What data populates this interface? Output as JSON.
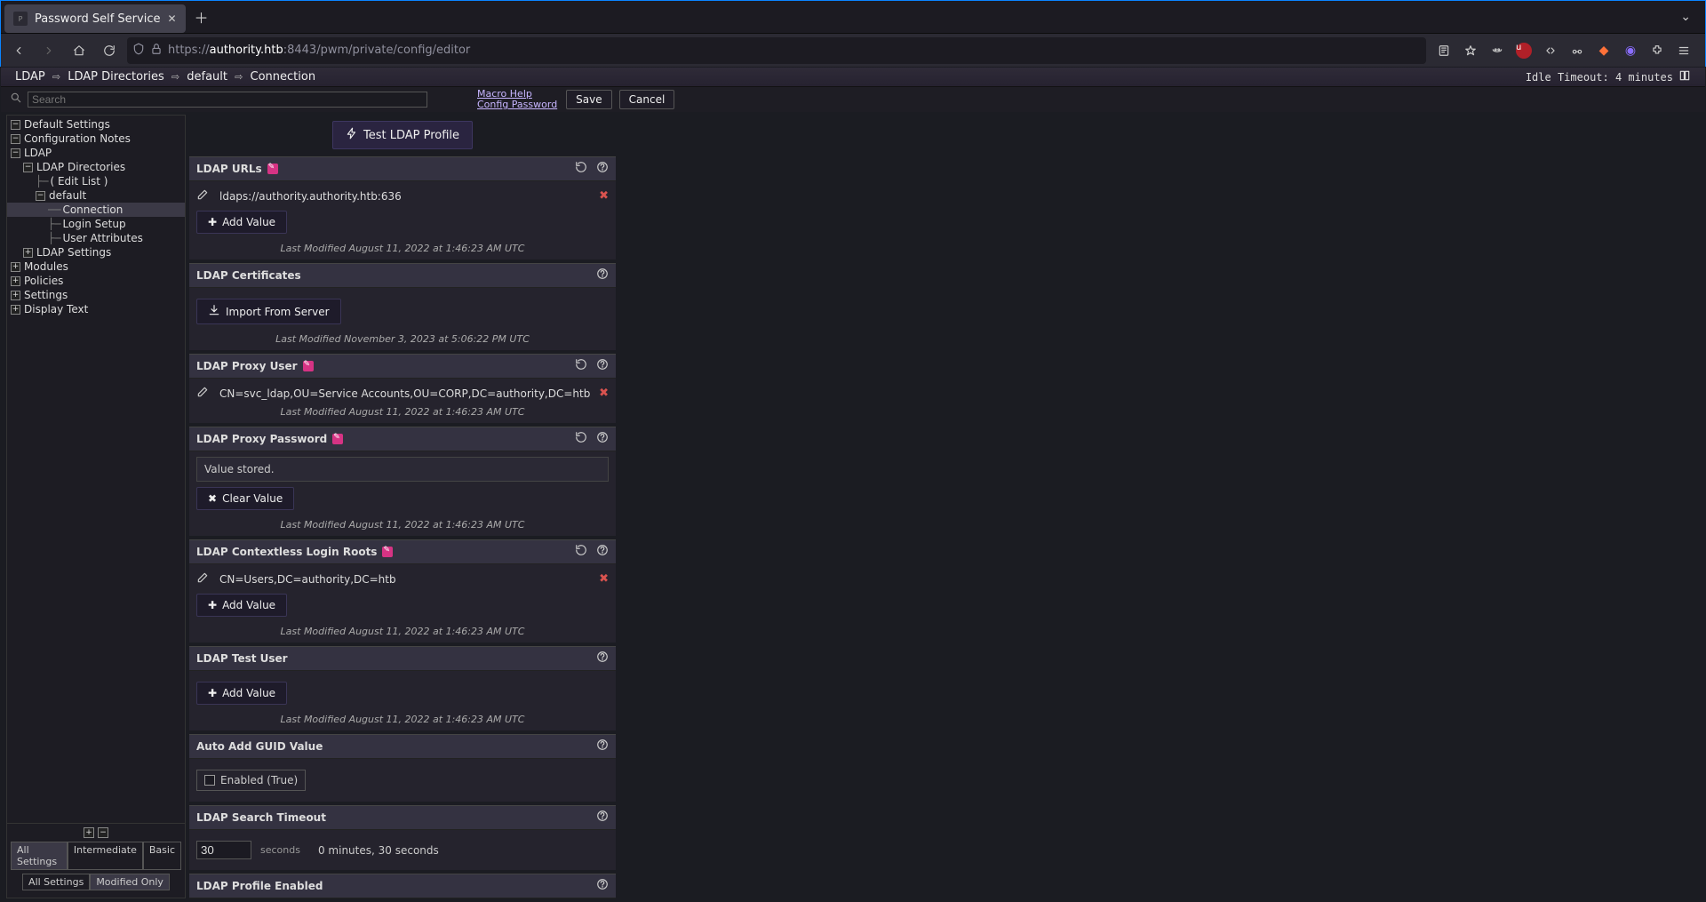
{
  "browser": {
    "tab_title": "Password Self Service",
    "url_display_prefix": "https://",
    "url_host": "authority.htb",
    "url_rest": ":8443/pwm/private/config/editor"
  },
  "breadcrumb": [
    "LDAP",
    "LDAP Directories",
    "default",
    "Connection"
  ],
  "idle_timeout": "Idle Timeout: 4 minutes",
  "search_placeholder": "Search",
  "links": {
    "macro_help": "Macro Help",
    "config_password": "Config Password"
  },
  "buttons": {
    "save": "Save",
    "cancel": "Cancel",
    "test_profile": "Test LDAP Profile",
    "add_value": "Add Value",
    "import_server": "Import From Server",
    "clear_value": "Clear Value"
  },
  "tree": {
    "items": [
      {
        "label": "Default Settings",
        "depth": 0,
        "exp": "-"
      },
      {
        "label": "Configuration Notes",
        "depth": 0,
        "exp": "-"
      },
      {
        "label": "LDAP",
        "depth": 0,
        "exp": "–"
      },
      {
        "label": "LDAP Directories",
        "depth": 1,
        "exp": "–"
      },
      {
        "label": "(  Edit List  )",
        "depth": 2,
        "exp": "|"
      },
      {
        "label": "default",
        "depth": 2,
        "exp": "–"
      },
      {
        "label": "Connection",
        "depth": 3,
        "exp": "-",
        "active": true
      },
      {
        "label": "Login Setup",
        "depth": 3,
        "exp": "|"
      },
      {
        "label": "User Attributes",
        "depth": 3,
        "exp": "|"
      },
      {
        "label": "LDAP Settings",
        "depth": 1,
        "exp": "+"
      },
      {
        "label": "Modules",
        "depth": 0,
        "exp": "+"
      },
      {
        "label": "Policies",
        "depth": 0,
        "exp": "+"
      },
      {
        "label": "Settings",
        "depth": 0,
        "exp": "+"
      },
      {
        "label": "Display Text",
        "depth": 0,
        "exp": "+"
      }
    ]
  },
  "filters": {
    "row1": [
      "All Settings",
      "Intermediate",
      "Basic"
    ],
    "row2": [
      "All Settings",
      "Modified Only"
    ]
  },
  "panels": {
    "urls": {
      "title": "LDAP URLs",
      "modified": true,
      "reset": true,
      "help": true,
      "value": "ldaps://authority.authority.htb:636",
      "lastmod": "Last Modified August 11, 2022 at 1:46:23 AM UTC"
    },
    "certs": {
      "title": "LDAP Certificates",
      "help": true,
      "lastmod": "Last Modified November 3, 2023 at 5:06:22 PM UTC"
    },
    "proxy_user": {
      "title": "LDAP Proxy User",
      "modified": true,
      "reset": true,
      "help": true,
      "value": "CN=svc_ldap,OU=Service Accounts,OU=CORP,DC=authority,DC=htb",
      "lastmod": "Last Modified August 11, 2022 at 1:46:23 AM UTC"
    },
    "proxy_pw": {
      "title": "LDAP Proxy Password",
      "modified": true,
      "reset": true,
      "help": true,
      "stored": "Value stored.",
      "lastmod": "Last Modified August 11, 2022 at 1:46:23 AM UTC"
    },
    "roots": {
      "title": "LDAP Contextless Login Roots",
      "modified": true,
      "reset": true,
      "help": true,
      "value": "CN=Users,DC=authority,DC=htb",
      "lastmod": "Last Modified August 11, 2022 at 1:46:23 AM UTC"
    },
    "test_user": {
      "title": "LDAP Test User",
      "help": true,
      "lastmod": "Last Modified August 11, 2022 at 1:46:23 AM UTC"
    },
    "guid": {
      "title": "Auto Add GUID Value",
      "help": true,
      "checkbox_label": "Enabled (True)"
    },
    "timeout": {
      "title": "LDAP Search Timeout",
      "help": true,
      "value": "30",
      "units": "seconds",
      "human": "0 minutes, 30 seconds"
    },
    "profile_enabled": {
      "title": "LDAP Profile Enabled",
      "help": true
    }
  }
}
